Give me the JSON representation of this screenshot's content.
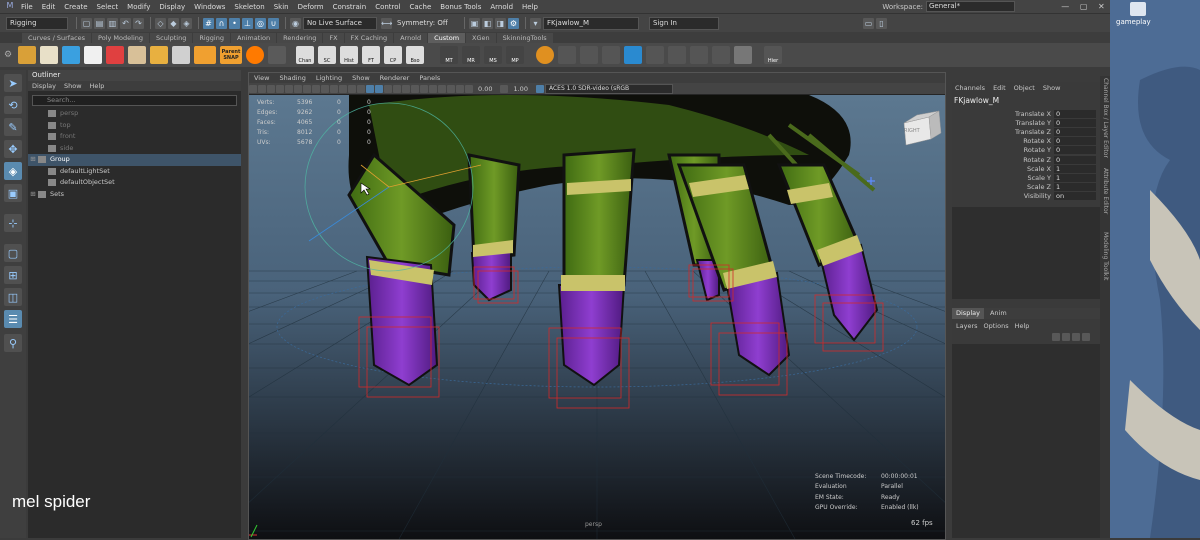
{
  "app": {
    "menu_items": [
      "File",
      "Edit",
      "Create",
      "Select",
      "Modify",
      "Display",
      "Windows",
      "Skeleton",
      "Skin",
      "Deform",
      "Constrain",
      "Control",
      "Cache",
      "Bonus Tools",
      "Arnold",
      "Help"
    ],
    "workspace_label": "Workspace:",
    "workspace_value": "General*"
  },
  "statusline": {
    "mode": "Rigging",
    "live_surface": "No Live Surface",
    "symmetry": "Symmetry: Off",
    "object_field": "FKjawlow_M",
    "sign_in": "Sign In"
  },
  "shelf": {
    "tabs": [
      "Curves / Surfaces",
      "Poly Modeling",
      "Sculpting",
      "Rigging",
      "Animation",
      "Rendering",
      "FX",
      "FX Caching",
      "Arnold",
      "Custom",
      "XGen",
      "SkinningTools"
    ],
    "active_tab": "Custom",
    "buttons": [
      "Chan",
      "SC",
      "Hist",
      "FT",
      "CP",
      "Bso",
      "MT",
      "MR",
      "MS",
      "MP",
      "Hier"
    ],
    "parent_snap_label": "Parent SNAP"
  },
  "outliner": {
    "title": "Outliner",
    "menus": [
      "Display",
      "Show",
      "Help"
    ],
    "search_placeholder": "Search...",
    "items": [
      {
        "label": "persp",
        "state": "dim"
      },
      {
        "label": "top",
        "state": "dim"
      },
      {
        "label": "front",
        "state": "dim"
      },
      {
        "label": "side",
        "state": "dim"
      },
      {
        "label": "Group",
        "state": "sel"
      },
      {
        "label": "defaultLightSet",
        "state": "normal"
      },
      {
        "label": "defaultObjectSet",
        "state": "normal"
      },
      {
        "label": "Sets",
        "state": "normal"
      }
    ]
  },
  "viewport": {
    "menus": [
      "View",
      "Shading",
      "Lighting",
      "Show",
      "Renderer",
      "Panels"
    ],
    "exposure": "0.00",
    "gamma": "1.00",
    "color_space": "ACES 1.0 SDR-video (sRGB",
    "camera_label": "persp",
    "view_cube_label": "RIGHT",
    "hud_stats": [
      {
        "label": "Verts:",
        "v1": "5396",
        "v2": "0",
        "v3": "0"
      },
      {
        "label": "Edges:",
        "v1": "9262",
        "v2": "0",
        "v3": "0"
      },
      {
        "label": "Faces:",
        "v1": "4065",
        "v2": "0",
        "v3": "0"
      },
      {
        "label": "Tris:",
        "v1": "8012",
        "v2": "0",
        "v3": "0"
      },
      {
        "label": "UVs:",
        "v1": "5678",
        "v2": "0",
        "v3": "0"
      }
    ],
    "hud_status": [
      {
        "label": "Scene Timecode:",
        "value": "00:00:00:01"
      },
      {
        "label": "Evaluation",
        "value": "Parallel"
      },
      {
        "label": "EM State:",
        "value": "Ready"
      },
      {
        "label": "GPU Override:",
        "value": "Enabled (llk)"
      }
    ],
    "fps": "62 fps"
  },
  "channel_box": {
    "menus": [
      "Channels",
      "Edit",
      "Object",
      "Show"
    ],
    "object_name": "FKjawlow_M",
    "attributes": [
      {
        "label": "Translate X",
        "value": "0"
      },
      {
        "label": "Translate Y",
        "value": "0"
      },
      {
        "label": "Translate Z",
        "value": "0"
      },
      {
        "label": "Rotate X",
        "value": "0"
      },
      {
        "label": "Rotate Y",
        "value": "0"
      },
      {
        "label": "Rotate Z",
        "value": "0"
      },
      {
        "label": "Scale X",
        "value": "1"
      },
      {
        "label": "Scale Y",
        "value": "1"
      },
      {
        "label": "Scale Z",
        "value": "1"
      },
      {
        "label": "Visibility",
        "value": "on"
      }
    ],
    "layer_tabs": [
      "Display",
      "Anim"
    ],
    "layer_menus": [
      "Layers",
      "Options",
      "Help"
    ],
    "side_tabs": [
      "Channel Box / Layer Editor",
      "Attribute Editor",
      "Modeling Toolkit"
    ]
  },
  "desktop": {
    "icon_label": "gameplay"
  },
  "caption": "mel spider",
  "colors": {
    "leg_green": "#5e8a1e",
    "claw_purple": "#7a2fb8",
    "band_yellow": "#c9c36a",
    "control_red": "#d22a2a",
    "selection_blue": "#5a8bb0"
  }
}
